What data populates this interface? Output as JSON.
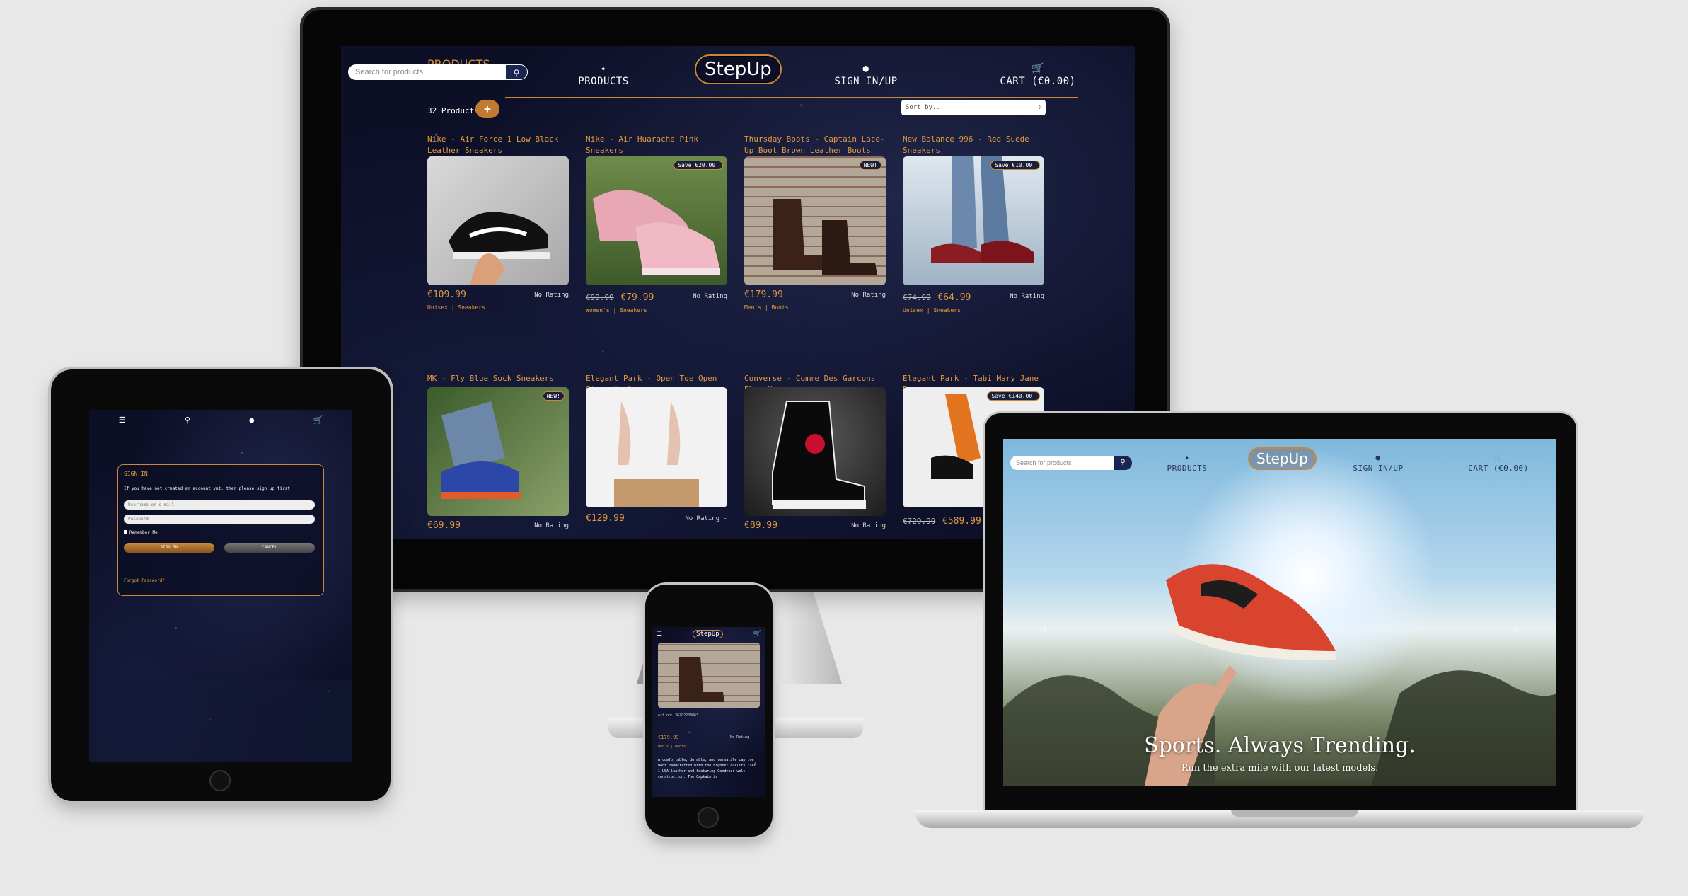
{
  "desktop": {
    "search_placeholder": "Search for products",
    "overlay_title": "PRODUCTS",
    "nav": {
      "products": "PRODUCTS",
      "logo": "StepUp",
      "sign": "SIGN IN/UP",
      "cart": "CART (€0.00)"
    },
    "count": "32 Products",
    "add_label": "+",
    "sort_label": "Sort by...",
    "products_row1": [
      {
        "name": "Nike - Air Force 1 Low Black Leather Sneakers",
        "price": "€109.99",
        "old": "",
        "rating": "No Rating",
        "category": "Unisex | Sneakers",
        "badge": ""
      },
      {
        "name": "Nike - Air Huarache Pink Sneakers",
        "price": "€79.99",
        "old": "€99.99",
        "rating": "No Rating",
        "category": "Women's | Sneakers",
        "badge": "Save €20.00!"
      },
      {
        "name": "Thursday Boots - Captain Lace-Up Boot Brown Leather Boots",
        "price": "€179.99",
        "old": "",
        "rating": "No Rating",
        "category": "Men's | Boots",
        "badge": "NEW!"
      },
      {
        "name": "New Balance 996 - Red Suede Sneakers",
        "price": "€64.99",
        "old": "€74.99",
        "rating": "No Rating",
        "category": "Unisex | Sneakers",
        "badge": "Save €10.00!"
      }
    ],
    "products_row2": [
      {
        "name": "MK - Fly Blue Sock Sneakers",
        "price": "€69.99",
        "old": "",
        "rating": "No Rating",
        "badge": "NEW!"
      },
      {
        "name": "Elegant Park - Open Toe Open Strap Heels",
        "price": "€129.99",
        "old": "",
        "rating": "No Rating -",
        "badge": ""
      },
      {
        "name": "Converse - Comme Des Garcons Play X",
        "price": "€89.99",
        "old": "",
        "rating": "No Rating",
        "badge": ""
      },
      {
        "name": "Elegant Park - Tabi Mary Jane Pumps",
        "price": "€589.99",
        "old": "€729.99",
        "rating": "",
        "badge": "Save €140.00!"
      }
    ]
  },
  "tablet": {
    "signin_title": "SIGN IN",
    "signin_text": "If you have not created an account yet, then please sign up first.",
    "username_placeholder": "Username or e-mail",
    "password_placeholder": "Password",
    "remember": "Remember Me",
    "signin_button": "SIGN IN",
    "cancel_button": "CANCEL",
    "forgot": "Forgot Password?"
  },
  "phone": {
    "logo": "StepUp",
    "art_no": "Art.no: 3GZ02203063",
    "price": "€179.99",
    "rating": "No Rating",
    "category": "Men's | Boots",
    "description": "A comfortable, durable, and versatile cap toe boot handcrafted with the highest quality Tier 1 USA leather and featuring Goodyear welt construction. The Captain is"
  },
  "laptop": {
    "search_placeholder": "Search for products",
    "nav": {
      "products": "PRODUCTS",
      "logo": "StepUp",
      "sign": "SIGN IN/UP",
      "cart": "CART (€0.00)"
    },
    "hero_title": "Sports. Always Trending.",
    "hero_sub": "Run the extra mile with our latest models."
  },
  "colors": {
    "accent": "#e39a3d",
    "navy": "#0c0f26"
  }
}
